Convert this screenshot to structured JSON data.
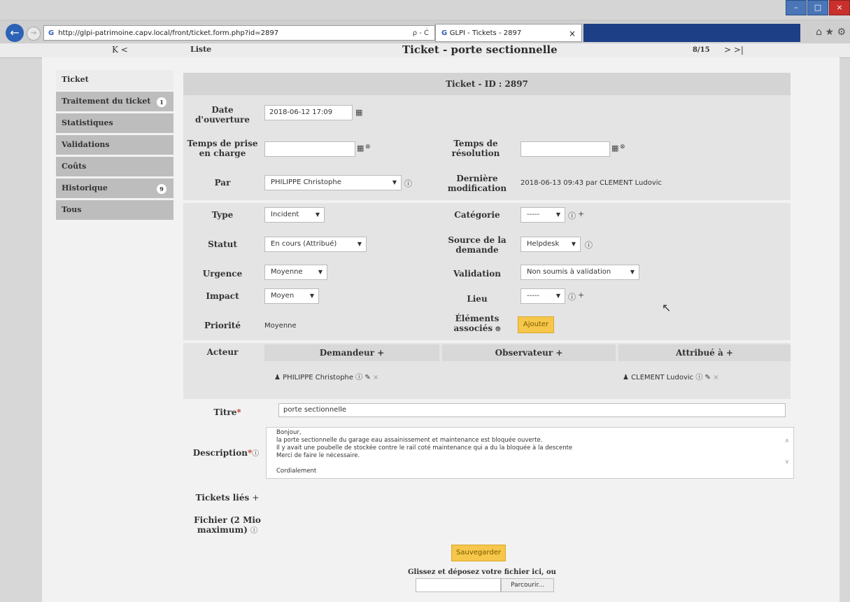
{
  "browser": {
    "url": "http://glpi-patrimoine.capv.local/front/ticket.form.php?id=2897",
    "address_icons": "ρ - Ċ",
    "tab_title": "GLPI - Tickets - 2897",
    "tab_close": "×",
    "window_buttons": [
      "–",
      "□",
      "×"
    ],
    "toolbar": "⌂ ★ ⚙"
  },
  "glpi_header": {
    "prev_nav": "K <",
    "list_link": "Liste",
    "title": "Ticket - porte sectionnelle",
    "position": "8/15",
    "next_nav": "> >|"
  },
  "sidebar": {
    "items": [
      {
        "label": "Ticket",
        "badge": ""
      },
      {
        "label": "Traitement du ticket",
        "badge": "1"
      },
      {
        "label": "Statistiques",
        "badge": ""
      },
      {
        "label": "Validations",
        "badge": ""
      },
      {
        "label": "Coûts",
        "badge": ""
      },
      {
        "label": "Historique",
        "badge": "9"
      },
      {
        "label": "Tous",
        "badge": ""
      }
    ]
  },
  "ticket": {
    "header": "Ticket - ID : 2897",
    "date_opening_label": "Date d'ouverture",
    "date_opening_value": "2018-06-12 17:09",
    "take_time_label": "Temps de prise en charge",
    "take_time_value": "",
    "resolution_label": "Temps de résolution",
    "resolution_value": "",
    "by_label": "Par",
    "by_value": "PHILIPPE Christophe",
    "last_mod_label": "Dernière modification",
    "last_mod_value": "2018-06-13 09:43 par CLEMENT Ludovic",
    "type_label": "Type",
    "type_value": "Incident",
    "category_label": "Catégorie",
    "category_value": "-----",
    "status_label": "Statut",
    "status_value": "En cours (Attribué)",
    "source_label": "Source de la demande",
    "source_value": "Helpdesk",
    "urgency_label": "Urgence",
    "urgency_value": "Moyenne",
    "validation_label": "Validation",
    "validation_value": "Non soumis à validation",
    "impact_label": "Impact",
    "impact_value": "Moyen",
    "location_label": "Lieu",
    "location_value": "-----",
    "priority_label": "Priorité",
    "priority_value": "Moyenne",
    "assoc_label": "Éléments associés",
    "add_button": "Ajouter",
    "actor_label": "Acteur",
    "requester_head": "Demandeur +",
    "observer_head": "Observateur +",
    "assigned_head": "Attribué à +",
    "requester_name": "PHILIPPE Christophe",
    "assigned_name": "CLEMENT Ludovic",
    "title_label": "Titre",
    "title_value": "porte sectionnelle",
    "description_label": "Description",
    "description_lines": [
      "Bonjour,",
      "la porte sectionnelle du garage eau assainissement et maintenance est bloquée ouverte.",
      "Il y avait une poubelle de stockée contre le rail coté maintenance qui a du la bloquée à la descente",
      "Merci de faire le nécessaire.",
      "",
      "Cordialement"
    ],
    "linked_label": "Tickets liés",
    "file_label": "Fichier (2 Mio maximum)",
    "save_button": "Sauvegarder",
    "dropzone_text": "Glissez et déposez votre fichier ici, ou",
    "browse_button": "Parcourir..."
  }
}
